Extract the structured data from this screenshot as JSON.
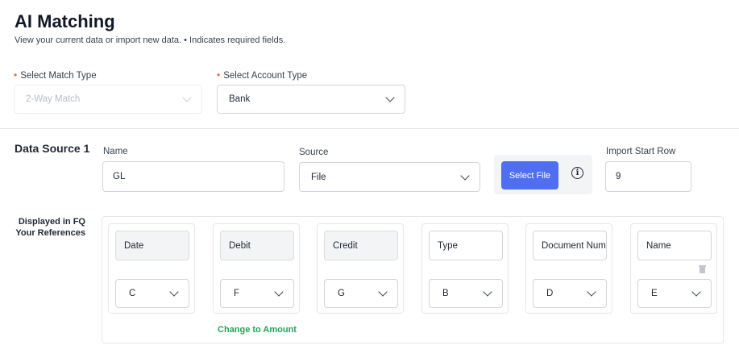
{
  "page": {
    "title": "AI Matching",
    "subtitle": "View your current data or import new data. • Indicates required fields."
  },
  "match_type": {
    "required_mark": "•",
    "label": "Select Match Type",
    "value": "2-Way Match",
    "disabled": true
  },
  "account_type": {
    "required_mark": "•",
    "label": "Select Account Type",
    "value": "Bank"
  },
  "data_source": {
    "title": "Data Source 1",
    "name_label": "Name",
    "name_value": "GL",
    "source_label": "Source",
    "source_value": "File",
    "select_file_label": "Select File",
    "import_start_row_label": "Import Start Row",
    "import_start_row_value": "9",
    "displayed_label_line1": "Displayed in FQ",
    "displayed_label_line2": "Your References",
    "columns": [
      {
        "name": "Date",
        "ref": "C"
      },
      {
        "name": "Debit",
        "ref": "F"
      },
      {
        "name": "Credit",
        "ref": "G"
      },
      {
        "name": "Type",
        "ref": "B"
      },
      {
        "name": "Document Number",
        "ref": "D"
      },
      {
        "name": "Name",
        "ref": "E"
      }
    ],
    "change_to_amount_label": "Change to Amount"
  },
  "icons": {
    "chevron": "chevron-down-icon",
    "info": "info-icon",
    "trash": "trash-icon"
  },
  "colors": {
    "primary_button": "#4f6ef2",
    "required_dot": "#e0693a",
    "link_green": "#22a35a"
  }
}
